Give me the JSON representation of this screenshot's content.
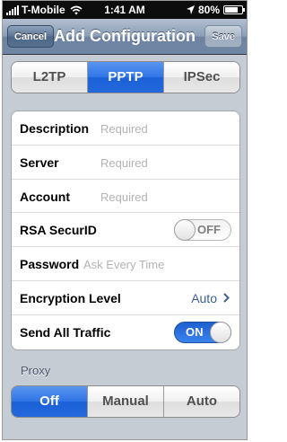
{
  "status_bar": {
    "carrier": "T-Mobile",
    "time": "1:41 AM",
    "battery": "80%",
    "battery_level": 0.8,
    "icons": [
      "signal-icon",
      "wifi-icon",
      "location-icon",
      "battery-icon"
    ]
  },
  "nav": {
    "title": "Add Configuration",
    "cancel_label": "Cancel",
    "save_label": "Save"
  },
  "vpn_type": {
    "options": [
      "L2TP",
      "PPTP",
      "IPSec"
    ],
    "selected": "PPTP"
  },
  "form": {
    "description": {
      "label": "Description",
      "placeholder": "Required"
    },
    "server": {
      "label": "Server",
      "placeholder": "Required"
    },
    "account": {
      "label": "Account",
      "placeholder": "Required"
    },
    "rsa_securid": {
      "label": "RSA SecurID",
      "state": "OFF"
    },
    "password": {
      "label": "Password",
      "placeholder": "Ask Every Time"
    },
    "encryption_level": {
      "label": "Encryption Level",
      "value": "Auto"
    },
    "send_all_traffic": {
      "label": "Send All Traffic",
      "state": "ON"
    }
  },
  "proxy": {
    "header": "Proxy",
    "options": [
      "Off",
      "Manual",
      "Auto"
    ],
    "selected": "Off"
  },
  "colors": {
    "accent_blue": "#2468dc",
    "nav_bar": "#6f86a4",
    "background": "#c5ccd4",
    "detail_text": "#3d5f8f"
  }
}
